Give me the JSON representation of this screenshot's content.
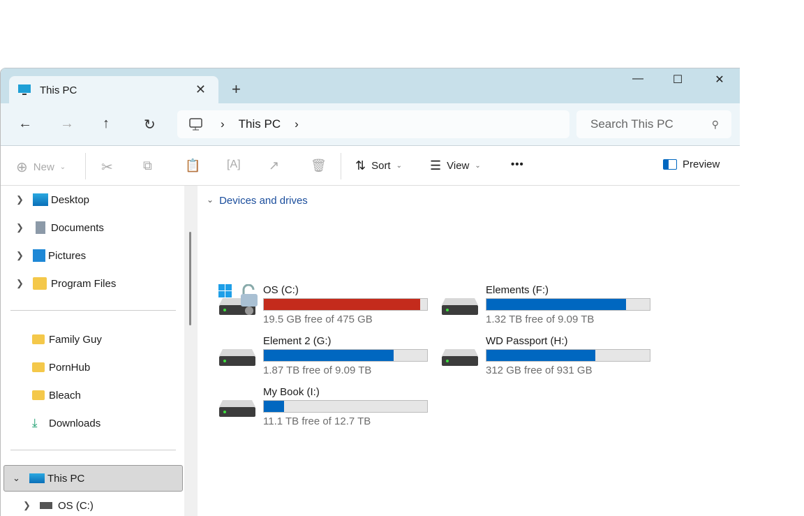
{
  "tab": {
    "title": "This PC",
    "close": "✕",
    "new_tab": "+"
  },
  "window": {
    "minimize": "—",
    "maximize": "☐",
    "close": "✕"
  },
  "address": {
    "crumbs": [
      "This PC"
    ],
    "search_placeholder": "Search This PC"
  },
  "toolbar": {
    "new": "New",
    "sort": "Sort",
    "view": "View",
    "more": "•••",
    "preview": "Preview"
  },
  "sidebar": {
    "top": [
      {
        "label": "Desktop"
      },
      {
        "label": "Documents"
      },
      {
        "label": "Pictures"
      },
      {
        "label": "Program Files"
      }
    ],
    "pinned": [
      {
        "label": "Family Guy"
      },
      {
        "label": "PornHub"
      },
      {
        "label": "Bleach"
      },
      {
        "label": "Downloads"
      }
    ],
    "this_pc": "This PC",
    "children": [
      {
        "label": "OS (C:)"
      }
    ]
  },
  "content": {
    "group": "Devices and drives",
    "drives": [
      {
        "name": "OS (C:)",
        "free": "19.5 GB free of 475 GB",
        "used_fraction": 0.959,
        "color": "#c42b1c"
      },
      {
        "name": "Elements (F:)",
        "free": "1.32 TB free of 9.09 TB",
        "used_fraction": 0.855,
        "color": "#0067c0"
      },
      {
        "name": "Element 2 (G:)",
        "free": "1.87 TB free of 9.09 TB",
        "used_fraction": 0.794,
        "color": "#0067c0"
      },
      {
        "name": "WD Passport (H:)",
        "free": "312 GB free of 931 GB",
        "used_fraction": 0.665,
        "color": "#0067c0"
      },
      {
        "name": "My Book (I:)",
        "free": "11.1 TB free of 12.7 TB",
        "used_fraction": 0.126,
        "color": "#0067c0"
      }
    ]
  }
}
